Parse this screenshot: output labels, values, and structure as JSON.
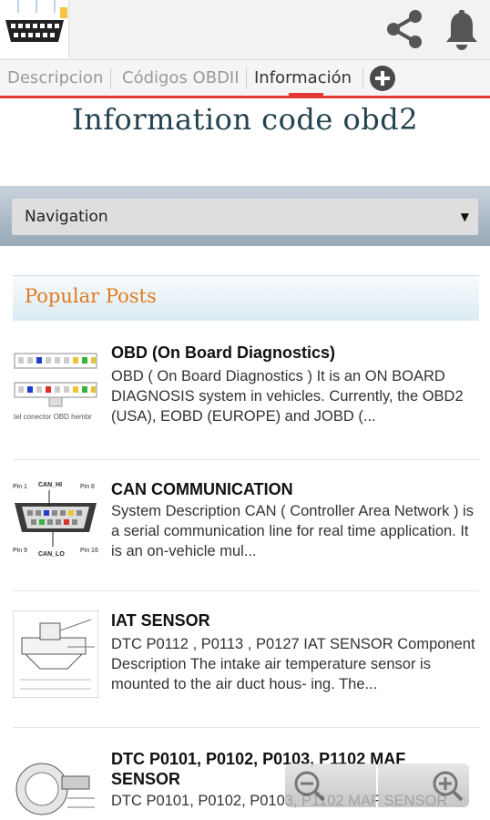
{
  "header": {
    "share_icon": "share-icon",
    "notification_icon": "bell-icon"
  },
  "tabs": [
    {
      "label": "Descripcion",
      "active": false
    },
    {
      "label": "Códigos OBDII",
      "active": false
    },
    {
      "label": "Información",
      "active": true
    }
  ],
  "page": {
    "title": "Information code obd2"
  },
  "navigation": {
    "selected": "Navigation"
  },
  "popular_posts": {
    "heading": "Popular Posts",
    "items": [
      {
        "title": "OBD (On Board Diagnostics)",
        "snippet": "OBD  ( On Board Diagnostics )  It is an ON BOARD DIAGNOSIS system in vehicles. Currently, the OBD2 (USA), EOBD (EUROPE) and JOBD (...",
        "thumb_caption": "tel conector OBD hembr"
      },
      {
        "title": "CAN COMMUNICATION",
        "snippet": "System Description CAN ( Controller Area Network ) is a serial communication line for real time application. It is an on-vehicle mul...",
        "thumb_labels": [
          "Pin 1",
          "CAN_HI",
          "Pin 8",
          "Pin 9",
          "CAN_LO",
          "Pin 16"
        ]
      },
      {
        "title": "IAT SENSOR",
        "snippet": "DTC P0112 , P0113 , P0127 IAT SENSOR Component Description The intake air temperature sensor is mounted to the air duct hous- ing. The..."
      },
      {
        "title": "DTC P0101, P0102, P0103, P1102 MAF SENSOR",
        "snippet": "DTC P0101, P0102, P0103, P1102 MAF SENSOR"
      }
    ]
  },
  "zoom": {
    "out_icon": "zoom-out-icon",
    "in_icon": "zoom-in-icon"
  }
}
